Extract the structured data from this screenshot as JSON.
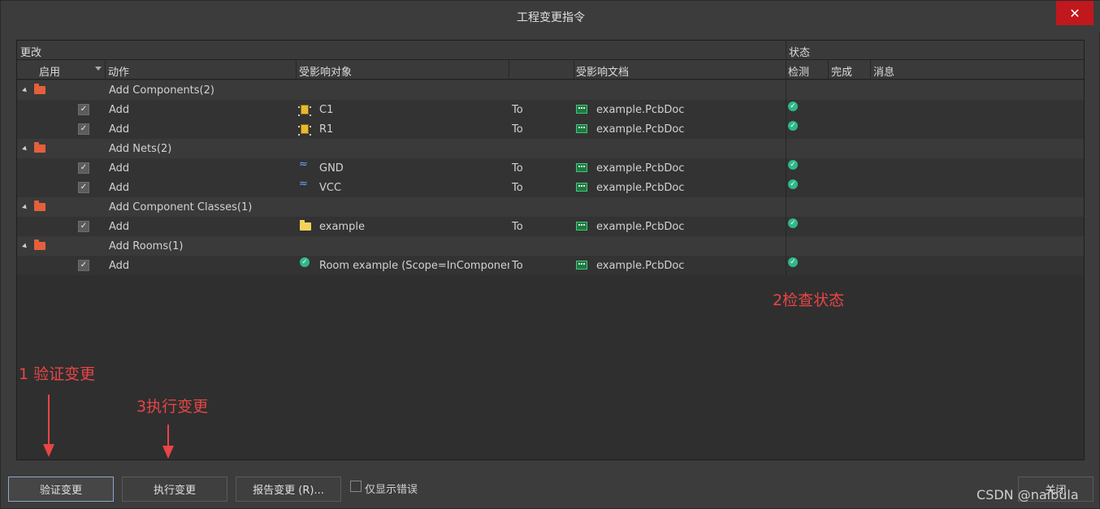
{
  "window": {
    "title": "工程变更指令",
    "close_glyph": "✕"
  },
  "header": {
    "group_changes": "更改",
    "group_status": "状态",
    "col_enable": "启用",
    "col_action": "动作",
    "col_target": "受影响对象",
    "col_doc": "受影响文档",
    "col_check": "检测",
    "col_done": "完成",
    "col_msg": "消息"
  },
  "groups": [
    {
      "label": "Add Components(2)",
      "rows": [
        {
          "action": "Add",
          "icon": "component-icon",
          "target": "C1",
          "to": "To",
          "doc": "example.PcbDoc"
        },
        {
          "action": "Add",
          "icon": "component-icon",
          "target": "R1",
          "to": "To",
          "doc": "example.PcbDoc"
        }
      ]
    },
    {
      "label": "Add Nets(2)",
      "rows": [
        {
          "action": "Add",
          "icon": "net-icon",
          "target": "GND",
          "to": "To",
          "doc": "example.PcbDoc"
        },
        {
          "action": "Add",
          "icon": "net-icon",
          "target": "VCC",
          "to": "To",
          "doc": "example.PcbDoc"
        }
      ]
    },
    {
      "label": "Add Component Classes(1)",
      "rows": [
        {
          "action": "Add",
          "icon": "folder-icon",
          "target": "example",
          "to": "To",
          "doc": "example.PcbDoc"
        }
      ]
    },
    {
      "label": "Add Rooms(1)",
      "rows": [
        {
          "action": "Add",
          "icon": "room-icon",
          "target": "Room example (Scope=InComponentC",
          "to": "To",
          "doc": "example.PcbDoc"
        }
      ]
    }
  ],
  "annotations": {
    "check_status": "2检查状态",
    "validate": "1 验证变更",
    "execute": "3执行变更"
  },
  "buttons": {
    "validate": "验证变更",
    "execute": "执行变更",
    "report": "报告变更 (R)...",
    "only_errors": "仅显示错误",
    "close": "关闭"
  },
  "watermark": "CSDN @naibula",
  "colors": {
    "ok": "#2fb88a",
    "annotation": "#e84545",
    "close_button": "#c0181d"
  }
}
